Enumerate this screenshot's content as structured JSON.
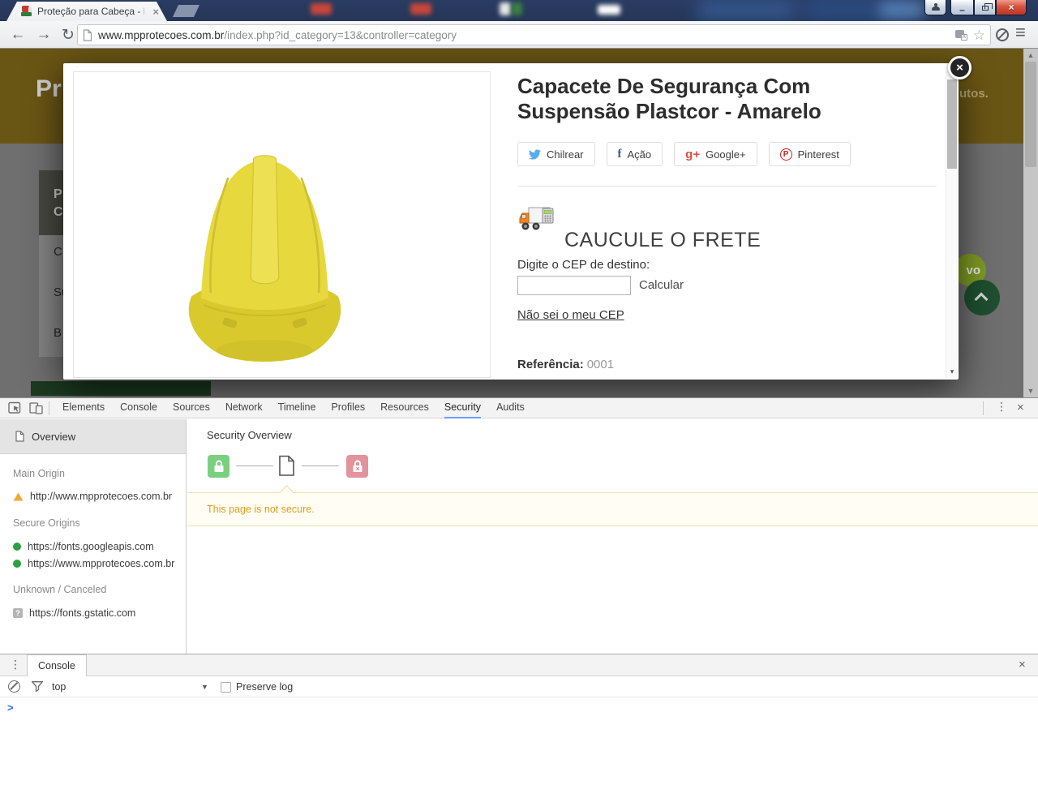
{
  "glyphs": {
    "back": "←",
    "forward": "→",
    "reload": "↻",
    "menu": "≡",
    "star": "☆",
    "close": "×",
    "minimize": "–",
    "kebab": "⋮",
    "dropdown_small": "▼",
    "scroll_up": "▲",
    "scroll_down": "▼",
    "modal_scroll_down": "▾",
    "question": "?"
  },
  "browser": {
    "tab": {
      "title": "Proteção para Cabeça - M"
    },
    "url": {
      "domain": "www.mpprotecoes.com.br",
      "path": "/index.php?id_category=13&controller=category"
    }
  },
  "page": {
    "logo_fragment": "Pr",
    "slogan_fragment": "utos.",
    "category_box": {
      "line1": "P",
      "line2": "C"
    },
    "menu_items": [
      "C",
      "Su",
      "B"
    ],
    "new_badge_fragment": "vo"
  },
  "modal": {
    "title": "Capacete De Segurança Com Suspensão Plastcor - Amarelo",
    "share_buttons": [
      {
        "icon": "twitter",
        "label": "Chilrear"
      },
      {
        "icon": "facebook",
        "icon_text": "f",
        "label": "Ação"
      },
      {
        "icon": "google-plus",
        "icon_text": "g+",
        "label": "Google+"
      },
      {
        "icon": "pinterest",
        "icon_text": "P",
        "label": "Pinterest"
      }
    ],
    "freight": {
      "heading": "CAUCULE O FRETE",
      "cep_label": "Digite o CEP de destino:",
      "cep_value": "",
      "calculate_label": "Calcular",
      "unknown_cep_link": "Não sei o meu CEP"
    },
    "reference": {
      "label": "Referência:",
      "value": "0001"
    }
  },
  "devtools": {
    "tabs": [
      "Elements",
      "Console",
      "Sources",
      "Network",
      "Timeline",
      "Profiles",
      "Resources",
      "Security",
      "Audits"
    ],
    "active_tab": "Security",
    "security": {
      "sidebar": {
        "overview": "Overview",
        "sections": [
          {
            "title": "Main Origin",
            "items": [
              {
                "status": "warning",
                "url": "http://www.mpprotecoes.com.br"
              }
            ]
          },
          {
            "title": "Secure Origins",
            "items": [
              {
                "status": "secure",
                "url": "https://fonts.googleapis.com"
              },
              {
                "status": "secure",
                "url": "https://www.mpprotecoes.com.br"
              }
            ]
          },
          {
            "title": "Unknown / Canceled",
            "items": [
              {
                "status": "unknown",
                "url": "https://fonts.gstatic.com"
              }
            ]
          }
        ]
      },
      "overview_title": "Security Overview",
      "status_message": "This page is not secure."
    },
    "console": {
      "tab": "Console",
      "context": "top",
      "preserve_log": "Preserve log",
      "prompt": ">"
    }
  },
  "colors": {
    "security_secure": "#7bd07f",
    "security_insecure": "#e2939b",
    "warning_text": "#e59d17",
    "devtools_accent": "#6e9ef7",
    "twitter": "#55acee",
    "facebook": "#3b5998",
    "google_plus": "#dc4e41",
    "pinterest": "#cb2027",
    "helmet_yellow": "#e7d83d",
    "site_header_brown": "#6a5614",
    "site_green": "#1e4f2f"
  }
}
